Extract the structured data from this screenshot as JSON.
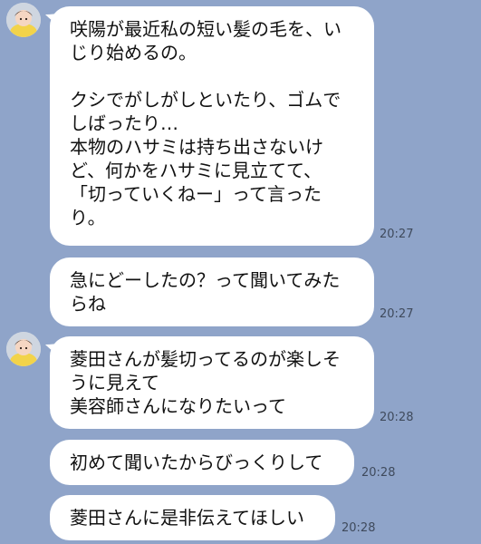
{
  "messages": [
    {
      "lines": [
        "咲陽が最近私の短い髪の毛を、い",
        "じり始めるの。",
        "",
        "クシでがしがしといたり、ゴムで",
        "しばったり…",
        "本物のハサミは持ち出さないけ",
        "ど、何かをハサミに見立てて、",
        "「切っていくねー」って言った",
        "り。"
      ],
      "time": "20:27"
    },
    {
      "lines": [
        "急にどーしたの？って聞いてみた",
        "らね"
      ],
      "time": "20:27"
    },
    {
      "lines": [
        "菱田さんが髪切ってるのが楽しそ",
        "うに見えて",
        "美容師さんになりたいって"
      ],
      "time": "20:28"
    },
    {
      "lines": [
        "初めて聞いたからびっくりして"
      ],
      "time": "20:28"
    },
    {
      "lines": [
        "菱田さんに是非伝えてほしい"
      ],
      "time": "20:28"
    }
  ],
  "colors": {
    "background": "#8fa4c9",
    "bubble": "#ffffff",
    "text": "#111111",
    "time": "#3f4a5c"
  }
}
